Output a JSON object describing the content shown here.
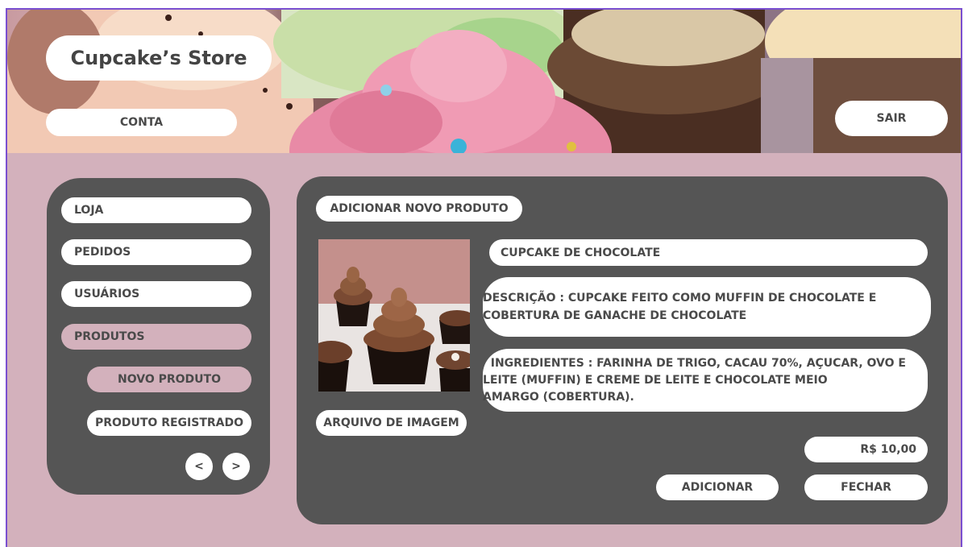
{
  "header": {
    "store_title": "Cupcake’s Store",
    "account_label": "CONTA",
    "logout_label": "SAIR"
  },
  "sidebar": {
    "items": [
      {
        "label": "LOJA"
      },
      {
        "label": "PEDIDOS"
      },
      {
        "label": "USUÁRIOS"
      },
      {
        "label": "PRODUTOS"
      },
      {
        "label": "NOVO PRODUTO"
      },
      {
        "label": "PRODUTO REGISTRADO"
      }
    ],
    "prev_label": "<",
    "next_label": ">",
    "active_color": "#d3b1bc"
  },
  "main": {
    "title": "ADICIONAR NOVO PRODUTO",
    "file_button_label": "ARQUIVO DE IMAGEM",
    "product_name": "CUPCAKE DE CHOCOLATE",
    "description": "DESCRIÇÃO : CUPCAKE FEITO COMO MUFFIN DE CHOCOLATE E COBERTURA DE GANACHE DE CHOCOLATE",
    "ingredients": "  INGREDIENTES : FARINHA DE TRIGO, CACAU 70%, AÇUCAR, OVO E\nLEITE (MUFFIN) E CREME DE LEITE E CHOCOLATE MEIO\nAMARGO (COBERTURA).",
    "price": "R$ 10,00",
    "add_label": "ADICIONAR",
    "close_label": "FECHAR"
  },
  "colors": {
    "background": "#d3b1bc",
    "panel": "#555555",
    "frame_border": "#7a4fd0",
    "pill": "#ffffff",
    "text": "#4a4a4a"
  }
}
